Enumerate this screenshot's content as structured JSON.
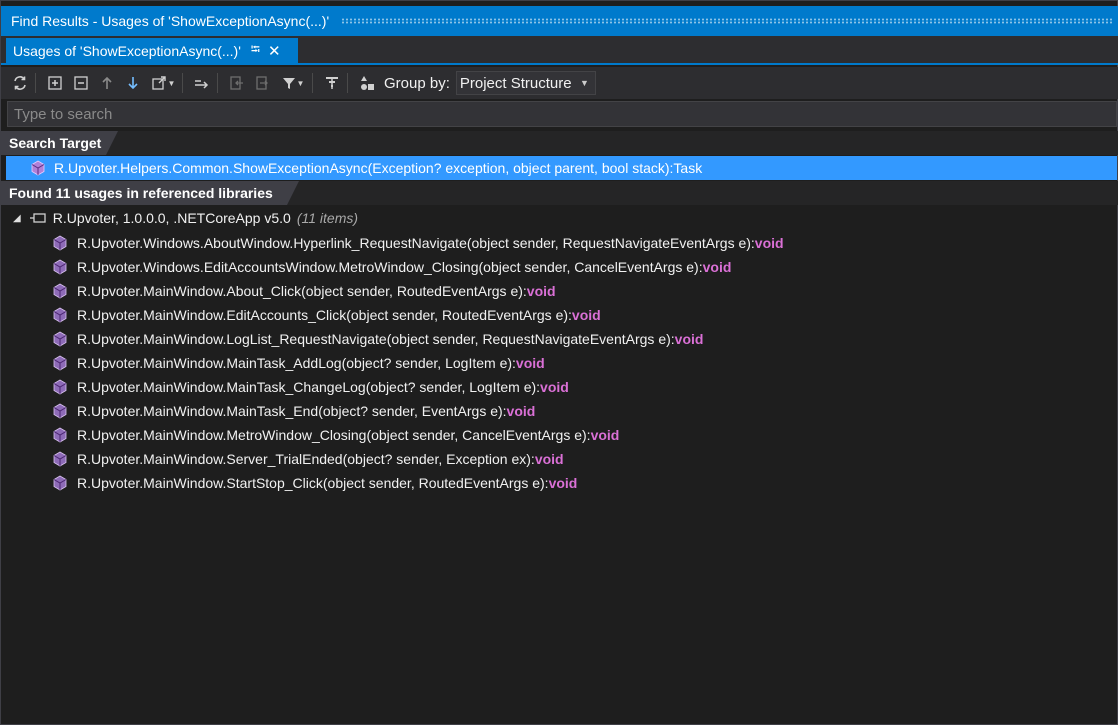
{
  "window": {
    "title": "Find Results - Usages of 'ShowExceptionAsync(...)'",
    "accent_color": "#007acc"
  },
  "tab": {
    "label": "Usages of 'ShowExceptionAsync(...)'",
    "pin_icon": "pin-icon",
    "close_icon": "close-icon"
  },
  "toolbar": {
    "group_by_label": "Group by:",
    "group_by_value": "Project Structure",
    "icons": [
      "refresh-icon",
      "expand-all-icon",
      "collapse-all-icon",
      "previous-icon",
      "next-icon",
      "open-in-new-tab-icon",
      "merge-icon",
      "go-back-icon",
      "go-forward-icon",
      "filter-icon",
      "group-icon",
      "group-by-icon"
    ]
  },
  "search": {
    "placeholder": "Type to search"
  },
  "search_target": {
    "header": "Search Target",
    "text": "R.Upvoter.Helpers.Common.ShowExceptionAsync(Exception? exception, object parent, bool stack):Task",
    "selected_color": "#3399ff"
  },
  "results": {
    "header": "Found 11 usages in referenced libraries",
    "assembly": {
      "label": "R.Upvoter, 1.0.0.0, .NETCoreApp v5.0",
      "count": "(11 items)"
    },
    "return_color": "#da70d6",
    "items": [
      {
        "text": "R.Upvoter.Windows.AboutWindow.Hyperlink_RequestNavigate(object sender, RequestNavigateEventArgs e):",
        "ret": "void"
      },
      {
        "text": "R.Upvoter.Windows.EditAccountsWindow.MetroWindow_Closing(object sender, CancelEventArgs e):",
        "ret": "void"
      },
      {
        "text": "R.Upvoter.MainWindow.About_Click(object sender, RoutedEventArgs e):",
        "ret": "void"
      },
      {
        "text": "R.Upvoter.MainWindow.EditAccounts_Click(object sender, RoutedEventArgs e):",
        "ret": "void"
      },
      {
        "text": "R.Upvoter.MainWindow.LogList_RequestNavigate(object sender, RequestNavigateEventArgs e):",
        "ret": "void"
      },
      {
        "text": "R.Upvoter.MainWindow.MainTask_AddLog(object? sender, LogItem e):",
        "ret": "void"
      },
      {
        "text": "R.Upvoter.MainWindow.MainTask_ChangeLog(object? sender, LogItem e):",
        "ret": "void"
      },
      {
        "text": "R.Upvoter.MainWindow.MainTask_End(object? sender, EventArgs e):",
        "ret": "void"
      },
      {
        "text": "R.Upvoter.MainWindow.MetroWindow_Closing(object sender, CancelEventArgs e):",
        "ret": "void"
      },
      {
        "text": "R.Upvoter.MainWindow.Server_TrialEnded(object? sender, Exception ex):",
        "ret": "void"
      },
      {
        "text": "R.Upvoter.MainWindow.StartStop_Click(object sender, RoutedEventArgs e):",
        "ret": "void"
      }
    ]
  }
}
